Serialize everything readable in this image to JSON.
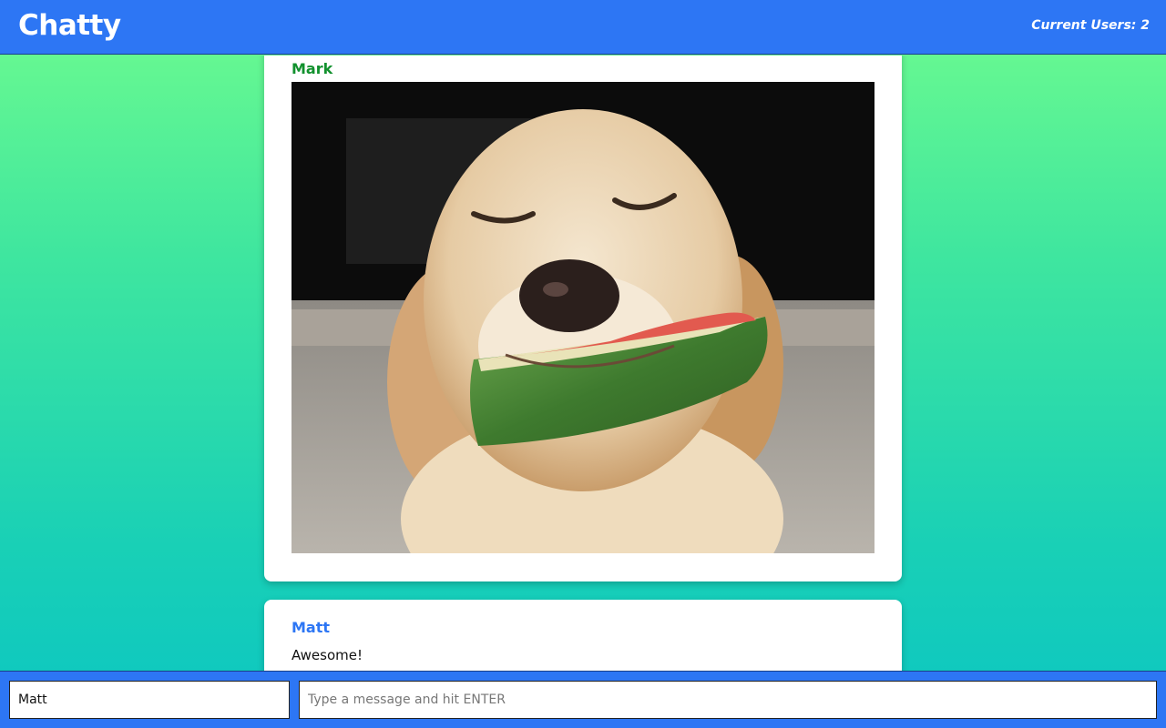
{
  "navbar": {
    "brand": "Chatty",
    "user_count": "Current Users: 2"
  },
  "messages": [
    {
      "username": "Mark",
      "username_color": "#12912e",
      "content_type": "image",
      "image_subject": "golden retriever holding a watermelon slice"
    },
    {
      "username": "Matt",
      "username_color": "#2d76f4",
      "content_type": "text",
      "text": "Awesome!"
    }
  ],
  "composer": {
    "name_value": "Matt",
    "message_placeholder": "Type a message and hit ENTER"
  },
  "colors": {
    "primary": "#2d76f4",
    "gradient_top": "#6ffc8e",
    "gradient_bottom": "#0cc6c2"
  }
}
